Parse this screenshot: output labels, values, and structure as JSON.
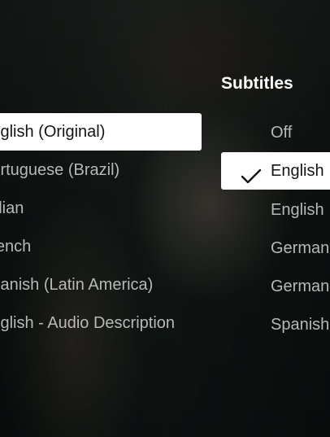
{
  "audio": {
    "options": [
      {
        "label": "English (Original)",
        "selected": true
      },
      {
        "label": "Portuguese (Brazil)",
        "selected": false
      },
      {
        "label": "Italian",
        "selected": false
      },
      {
        "label": "French",
        "selected": false
      },
      {
        "label": "Spanish (Latin America)",
        "selected": false
      },
      {
        "label": "English - Audio Description",
        "selected": false
      }
    ]
  },
  "subtitles": {
    "heading": "Subtitles",
    "options": [
      {
        "label": "Off",
        "selected": false
      },
      {
        "label": "English",
        "selected": true
      },
      {
        "label": "English",
        "selected": false
      },
      {
        "label": "German",
        "selected": false
      },
      {
        "label": "German",
        "selected": false
      },
      {
        "label": "Spanish",
        "selected": false
      }
    ]
  },
  "icons": {
    "selected_marker": "checkmark-icon"
  },
  "colors": {
    "selected_bg": "#ffffff",
    "text": "#b8b8b8",
    "heading": "#ffffff"
  }
}
